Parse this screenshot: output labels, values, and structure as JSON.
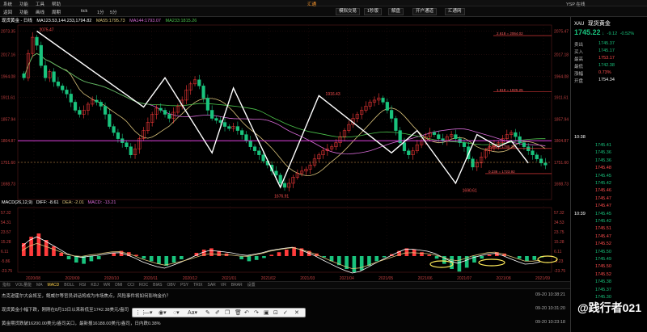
{
  "app": {
    "menu": [
      "系统",
      "功能",
      "工具",
      "帮助"
    ],
    "title": "汇通",
    "top_right": "YSP 在线"
  },
  "toolbar": {
    "items": [
      "返回",
      "功能",
      "画线",
      "周期",
      "tick",
      "1分",
      "5分"
    ],
    "buttons": [
      "模拟交易",
      "1秒版",
      "解盘",
      "开户通道",
      "汇通网"
    ]
  },
  "ma_legend": {
    "symbol": "现货黄金 - 日线",
    "ma": "MA123.53,144.233,1794.82",
    "ma55": "MA55:1795.73",
    "ma144": "MA144:1793.07",
    "ma233": "MA233:1815.26"
  },
  "chart_data": {
    "type": "candlestick",
    "symbol": "现货黄金",
    "period": "日线",
    "x_labels": [
      "2020/08",
      "2020/09",
      "2020/10",
      "2020/11",
      "2020/12",
      "2021/01",
      "2021/02",
      "2021/03",
      "2021/04",
      "2021/05",
      "2021/06",
      "2021/07",
      "2021/08",
      "2021/09"
    ],
    "y_ticks_right": [
      "2075.47",
      "2017.18",
      "1964.08",
      "1911.61",
      "1857.94",
      "1804.87",
      "1751.60",
      "1698.73"
    ],
    "y_ticks_left": [
      "2073.35",
      "2017.16",
      "1964.08",
      "1911.61",
      "1857.94",
      "1804.87",
      "1751.60",
      "1698.73"
    ],
    "ylim": [
      1660,
      2090
    ],
    "annotations": [
      {
        "text": "2075.47",
        "x": "2020/08",
        "y": 2075.47
      },
      {
        "text": "1916.43",
        "x": "2021/05",
        "y": 1916.43
      },
      {
        "text": "1676.91",
        "x": "2021/03",
        "y": 1676.91
      },
      {
        "text": "1690.61",
        "x": "2021/08",
        "y": 1690.61
      }
    ],
    "fib_levels": [
      {
        "label": "2.618 = 2064.02",
        "y": 2064.02
      },
      {
        "label": "1.618 = 1925.25",
        "y": 1925.25
      },
      {
        "label": "0.382 = 1785.75",
        "y": 1785.75
      },
      {
        "label": "0.236 = 1723.92",
        "y": 1723.92
      }
    ],
    "current_price_line": 1804.87,
    "price_labels": [
      "1751.60"
    ],
    "closes": [
      1960,
      2020,
      2060,
      2040,
      1990,
      1960,
      1975,
      1950,
      1940,
      1930,
      1920,
      1900,
      1880,
      1870,
      1880,
      1895,
      1905,
      1900,
      1890,
      1870,
      1840,
      1825,
      1810,
      1800,
      1790,
      1770,
      1785,
      1810,
      1830,
      1850,
      1870,
      1885,
      1880,
      1870,
      1860,
      1875,
      1890,
      1905,
      1930,
      1945,
      1955,
      1940,
      1910,
      1880,
      1860,
      1855,
      1850,
      1840,
      1835,
      1840,
      1830,
      1820,
      1805,
      1790,
      1780,
      1770,
      1755,
      1745,
      1730,
      1720,
      1700,
      1690,
      1700,
      1715,
      1725,
      1730,
      1735,
      1745,
      1760,
      1770,
      1780,
      1785,
      1790,
      1800,
      1815,
      1830,
      1845,
      1860,
      1870,
      1880,
      1890,
      1900,
      1905,
      1910,
      1900,
      1880,
      1860,
      1830,
      1800,
      1780,
      1770,
      1780,
      1795,
      1805,
      1815,
      1825,
      1820,
      1810,
      1805,
      1815,
      1820,
      1810,
      1800,
      1790,
      1760,
      1740,
      1750,
      1765,
      1780,
      1790,
      1795,
      1800,
      1810,
      1820,
      1825,
      1815,
      1800,
      1790,
      1780,
      1770,
      1760,
      1750,
      1745
    ],
    "ma_series": [
      {
        "name": "MA55",
        "color": "#d9c27a"
      },
      {
        "name": "MA144",
        "color": "#d96bd9"
      },
      {
        "name": "MA233",
        "color": "#4cc44c"
      }
    ]
  },
  "macd": {
    "legend": "MACD(26,12,9)",
    "diff": "DIFF: -8.61",
    "dea": "DEA: -2.01",
    "macd": "MACD: -13.21",
    "y_ticks_left": [
      "57.32",
      "54.31",
      "23.57",
      "15.28",
      "6.11",
      "-5.86",
      "-23.75"
    ],
    "y_ticks_right": [
      "57.32",
      "34.53",
      "23.75",
      "15.28",
      "6.11",
      "-5.23",
      "-23.75"
    ],
    "histogram": [
      20,
      30,
      35,
      25,
      15,
      5,
      -5,
      -10,
      -12,
      -8,
      -5,
      0,
      5,
      8,
      6,
      2,
      -4,
      -8,
      -12,
      -15,
      -10,
      -5,
      0,
      5,
      10,
      12,
      8,
      4,
      0,
      -5,
      -8,
      -6,
      -3,
      2,
      6,
      10,
      14,
      12,
      8,
      4,
      -2,
      -8,
      -14,
      -20,
      -25,
      -22,
      -15,
      -8,
      -2,
      3,
      8,
      12,
      10,
      6,
      2,
      -4,
      -12,
      -20,
      -24,
      -18,
      -10,
      -4,
      2,
      6,
      4,
      0,
      -4,
      -8,
      -6,
      -2
    ]
  },
  "bottom_tabs": [
    "指标",
    "VOL量能",
    "MA",
    "MACD",
    "BOLL",
    "RSI",
    "KDJ",
    "WR",
    "DMI",
    "CCI",
    "ROC",
    "BIAS",
    "OBV",
    "PSY",
    "TRIX",
    "SAR",
    "VR",
    "BRAR",
    "设置"
  ],
  "news": [
    {
      "text": "杰克逊霍尔大会将至，鲍威尔等官员讲话将成为市场焦点，风险事件将如何影响金价？",
      "time": "09-20 10:38:21"
    },
    {
      "text": "现货黄金小幅下跌，刚刚在8月13日以来新低至1742.38美元/盎司",
      "time": "09-20 10:31:20"
    },
    {
      "text": "黄金期货跌破16200.00美元/盎司关口，最新报16188.00美元/盎司，日内跌0.38%",
      "time": "09-20 10:23:18"
    }
  ],
  "watermark": "@践行者021",
  "sidebar": {
    "code": "XAU",
    "name": "现货黄金",
    "price": "1745.22",
    "arrow": "↓",
    "change": "-9.12",
    "change_pct": "-0.52%",
    "rows": [
      {
        "label": "卖出",
        "value": "1745.37",
        "color": "#19c37d"
      },
      {
        "label": "买入",
        "value": "1745.17",
        "color": "#19c37d"
      },
      {
        "label": "最高",
        "value": "1753.17",
        "color": "#ff4d4d"
      },
      {
        "label": "最低",
        "value": "1742.38",
        "color": "#19c37d"
      },
      {
        "label": "涨幅",
        "value": "0.73%",
        "color": "#ff4d4d"
      },
      {
        "label": "开盘",
        "value": "1754.34",
        "color": "#eeeeee"
      }
    ],
    "tick_header": "10:38",
    "ticks": [
      {
        "price": "1745.41",
        "dir": "dn"
      },
      {
        "price": "1745.36",
        "dir": "dn"
      },
      {
        "price": "1745.36",
        "dir": "dn"
      },
      {
        "price": "1745.48",
        "dir": "up"
      },
      {
        "price": "1745.45",
        "dir": "dn"
      },
      {
        "price": "1745.42",
        "dir": "dn"
      },
      {
        "price": "1745.46",
        "dir": "up"
      },
      {
        "price": "1745.47",
        "dir": "up"
      },
      {
        "price": "1745.47",
        "dir": "up"
      },
      {
        "price": "1745.45",
        "dir": "dn"
      },
      {
        "price": "1745.42",
        "dir": "dn"
      },
      {
        "price": "1745.51",
        "dir": "up"
      },
      {
        "price": "1745.47",
        "dir": "up"
      },
      {
        "price": "1745.52",
        "dir": "up"
      },
      {
        "price": "1745.50",
        "dir": "dn"
      },
      {
        "price": "1745.49",
        "dir": "dn"
      },
      {
        "price": "1745.50",
        "dir": "up"
      },
      {
        "price": "1745.52",
        "dir": "up"
      },
      {
        "price": "1745.38",
        "dir": "dn"
      },
      {
        "price": "1745.37",
        "dir": "dn"
      },
      {
        "price": "1745.30",
        "dir": "dn"
      }
    ],
    "tick_header2": "10:39"
  }
}
